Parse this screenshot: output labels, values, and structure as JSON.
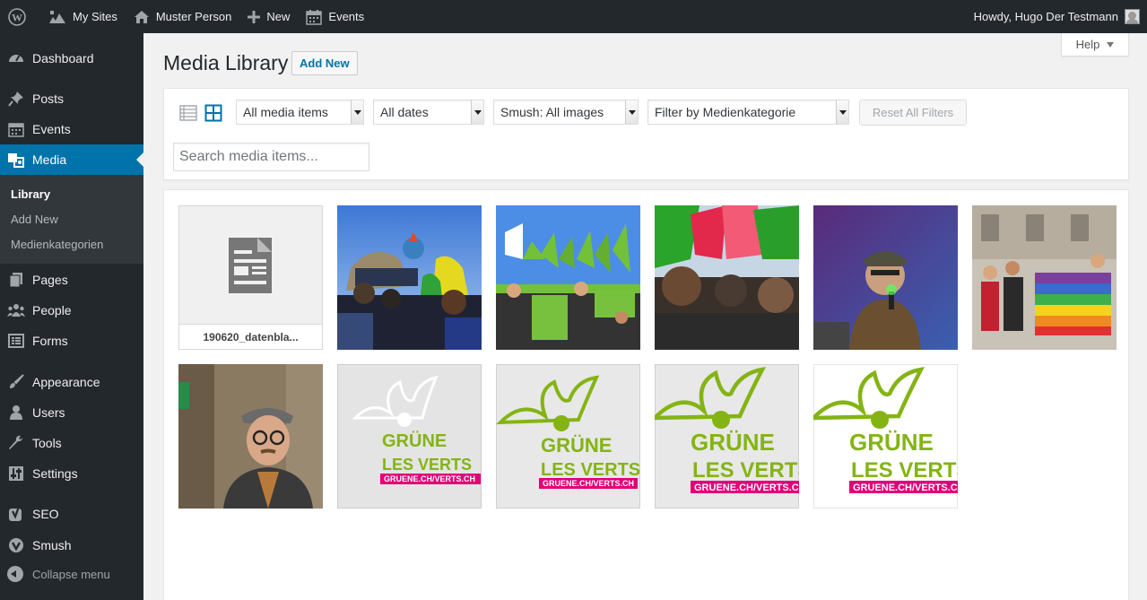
{
  "admin_bar": {
    "my_sites": "My Sites",
    "site_name": "Muster Person",
    "new": "New",
    "events": "Events",
    "howdy": "Howdy, Hugo Der Testmann"
  },
  "sidebar": {
    "items": [
      {
        "label": "Dashboard"
      },
      {
        "label": "Posts"
      },
      {
        "label": "Events"
      },
      {
        "label": "Media"
      },
      {
        "label": "Pages"
      },
      {
        "label": "People"
      },
      {
        "label": "Forms"
      },
      {
        "label": "Appearance"
      },
      {
        "label": "Users"
      },
      {
        "label": "Tools"
      },
      {
        "label": "Settings"
      },
      {
        "label": "SEO"
      },
      {
        "label": "Smush"
      }
    ],
    "submenu": [
      {
        "label": "Library"
      },
      {
        "label": "Add New"
      },
      {
        "label": "Medienkategorien"
      }
    ],
    "collapse": "Collapse menu"
  },
  "help": "Help",
  "page": {
    "title": "Media Library",
    "add_new": "Add New"
  },
  "filters": {
    "media_type": "All media items",
    "dates": "All dates",
    "smush": "Smush: All images",
    "category": "Filter by Medienkategorie",
    "reset": "Reset All Filters",
    "search_placeholder": "Search media items..."
  },
  "media": {
    "items": [
      {
        "filename": "190620_datenbla..."
      }
    ],
    "logo": {
      "line1": "GRÜNE",
      "line2": "LES VERTS",
      "url": "GRUENE.CH/VERTS.CH"
    }
  },
  "colors": {
    "accent": "#0073aa",
    "admin_dark": "#23282d",
    "green_logo": "#84b414",
    "magenta_logo": "#e10078"
  }
}
